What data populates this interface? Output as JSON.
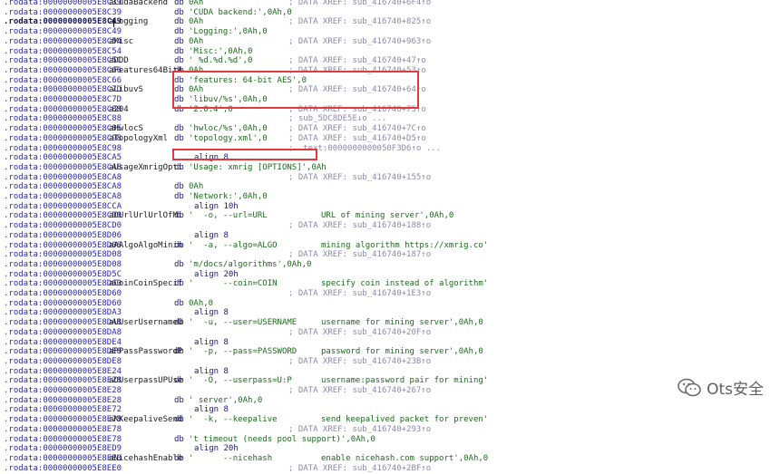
{
  "rows": [
    {
      "addr": ".rodata:00000000005E8C39",
      "label": "aCudaBackend",
      "mn": "db",
      "op": "0Ah",
      "cm": "; DATA XREF: sub_416740+6F4↑o"
    },
    {
      "addr": ".rodata:00000000005E8C39",
      "label": "",
      "mn": "db",
      "op": "'CUDA backend:',0Ah,0",
      "cm": ""
    },
    {
      "addr": ".rodata:00000000005E8C49",
      "label": "aLogging",
      "mn": "db",
      "op": "0Ah",
      "cm": "; DATA XREF: sub_416740+825↑o",
      "hl": true
    },
    {
      "addr": ".rodata:00000000005E8C49",
      "label": "",
      "mn": "db",
      "op": "'Logging:',0Ah,0",
      "cm": ""
    },
    {
      "addr": ".rodata:00000000005E8C54",
      "label": "aMisc",
      "mn": "db",
      "op": "0Ah",
      "cm": "; DATA XREF: sub_416740+963↑o"
    },
    {
      "addr": ".rodata:00000000005E8C54",
      "label": "",
      "mn": "db",
      "op": "'Misc:',0Ah,0",
      "cm": ""
    },
    {
      "addr": ".rodata:00000000005E8C5C",
      "label": "aDDD",
      "mn": "db",
      "op": "' %d.%d.%d',0",
      "cm": "; DATA XREF: sub_416740+47↑o"
    },
    {
      "addr": ".rodata:00000000005E8C66",
      "label": "aFeatures64BitA",
      "mn": "db",
      "op": "0Ah",
      "cm": "; DATA XREF: sub_416740+53↑o"
    },
    {
      "addr": ".rodata:00000000005E8C66",
      "label": "",
      "mn": "db",
      "op": "'features: 64-bit AES',0",
      "cm": ""
    },
    {
      "addr": ".rodata:00000000005E8C7D",
      "label": "aLibuvS",
      "mn": "db",
      "op": "0Ah",
      "cm": "; DATA XREF: sub_416740+64↑o"
    },
    {
      "addr": ".rodata:00000000005E8C7D",
      "label": "",
      "mn": "db",
      "op": "'libuv/%s',0Ah,0",
      "cm": ""
    },
    {
      "addr": ".rodata:00000000005E8C88",
      "label": "a204",
      "mn": "db",
      "op": "'2.0.4',0",
      "cm": "; DATA XREF: sub_416740+75↑o"
    },
    {
      "addr": ".rodata:00000000005E8C88",
      "label": "",
      "mn": "",
      "op": "",
      "cm": "; sub_5DC8DE5E↓o ..."
    },
    {
      "addr": ".rodata:00000000005E8C8E",
      "label": "aHwlocS",
      "mn": "db",
      "op": "'hwloc/%s',0Ah,0",
      "cm": "; DATA XREF: sub_416740+7C↑o"
    },
    {
      "addr": ".rodata:00000000005E8C98",
      "label": "aTopologyXml",
      "mn": "db",
      "op": "'topology.xml',0",
      "cm": "; DATA XREF: sub_416740+D5↑o"
    },
    {
      "addr": ".rodata:00000000005E8C98",
      "label": "",
      "mn": "",
      "op": "",
      "cm": "; .text:0000000000050F3D6↑o ..."
    },
    {
      "addr": ".rodata:00000000005E8CA5",
      "label": "",
      "mn": "align 8",
      "op": "",
      "cm": ""
    },
    {
      "addr": ".rodata:00000000005E8CA8",
      "label": "aUsageXmrigOpti",
      "mn": "db",
      "op": "'Usage: xmrig [OPTIONS]',0Ah",
      "cm": ""
    },
    {
      "addr": ".rodata:00000000005E8CA8",
      "label": "",
      "mn": "",
      "op": "",
      "cm": "; DATA XREF: sub_416740+155↑o"
    },
    {
      "addr": ".rodata:00000000005E8CA8",
      "label": "",
      "mn": "db",
      "op": "0Ah",
      "cm": ""
    },
    {
      "addr": ".rodata:00000000005E8CA8",
      "label": "",
      "mn": "db",
      "op": "'Network:',0Ah,0",
      "cm": ""
    },
    {
      "addr": ".rodata:00000000005E8CCA",
      "label": "",
      "mn": "align 10h",
      "op": "",
      "cm": ""
    },
    {
      "addr": ".rodata:00000000005E8CD0",
      "label": "aOUrlUrlUrlOfMi",
      "mn": "db",
      "op": "'  -o, --url=URL",
      "ex": "URL of mining server',0Ah,0",
      "cm": ""
    },
    {
      "addr": ".rodata:00000000005E8CD0",
      "label": "",
      "mn": "",
      "op": "",
      "cm": "; DATA XREF: sub_416740+188↑o"
    },
    {
      "addr": ".rodata:00000000005E8D06",
      "label": "",
      "mn": "align 8",
      "op": "",
      "cm": ""
    },
    {
      "addr": ".rodata:00000000005E8D08",
      "label": "aAAlgoAlgoMinin",
      "mn": "db",
      "op": "'  -a, --algo=ALGO",
      "ex": "mining algorithm https://xmrig.co'",
      "cm": ""
    },
    {
      "addr": ".rodata:00000000005E8D08",
      "label": "",
      "mn": "",
      "op": "",
      "cm": "; DATA XREF: sub_416740+187↑o"
    },
    {
      "addr": ".rodata:00000000005E8D08",
      "label": "",
      "mn": "db",
      "op": "'m/docs/algorithms',0Ah,0",
      "cm": ""
    },
    {
      "addr": ".rodata:00000000005E8D5C",
      "label": "",
      "mn": "align 20h",
      "op": "",
      "cm": ""
    },
    {
      "addr": ".rodata:00000000005E8D60",
      "label": "aCoinCoinSpecif",
      "mn": "db",
      "op": "'      --coin=COIN",
      "ex": "specify coin instead of algorithm'",
      "cm": ""
    },
    {
      "addr": ".rodata:00000000005E8D60",
      "label": "",
      "mn": "",
      "op": "",
      "cm": "; DATA XREF: sub_416740+1E3↑o"
    },
    {
      "addr": ".rodata:00000000005E8D60",
      "label": "",
      "mn": "db",
      "op": "0Ah,0",
      "cm": ""
    },
    {
      "addr": ".rodata:00000000005E8DA3",
      "label": "",
      "mn": "align 8",
      "op": "",
      "cm": ""
    },
    {
      "addr": ".rodata:00000000005E8DA8",
      "label": "aUUserUsernameU",
      "mn": "db",
      "op": "'  -u, --user=USERNAME",
      "ex": "username for mining server',0Ah,0",
      "cm": ""
    },
    {
      "addr": ".rodata:00000000005E8DA8",
      "label": "",
      "mn": "",
      "op": "",
      "cm": "; DATA XREF: sub_416740+20F↑o"
    },
    {
      "addr": ".rodata:00000000005E8DE4",
      "label": "",
      "mn": "align 8",
      "op": "",
      "cm": ""
    },
    {
      "addr": ".rodata:00000000005E8DE8",
      "label": "aPPassPasswordP",
      "mn": "db",
      "op": "'  -p, --pass=PASSWORD",
      "ex": "password for mining server',0Ah,0",
      "cm": ""
    },
    {
      "addr": ".rodata:00000000005E8DE8",
      "label": "",
      "mn": "",
      "op": "",
      "cm": "; DATA XREF: sub_416740+23B↑o"
    },
    {
      "addr": ".rodata:00000000005E8E24",
      "label": "",
      "mn": "align 8",
      "op": "",
      "cm": ""
    },
    {
      "addr": ".rodata:00000000005E8E28",
      "label": "aOUserpassUPUse",
      "mn": "db",
      "op": "'  -O, --userpass=U:P",
      "ex": "username:password pair for mining'",
      "cm": ""
    },
    {
      "addr": ".rodata:00000000005E8E28",
      "label": "",
      "mn": "",
      "op": "",
      "cm": "; DATA XREF: sub_416740+267↑o"
    },
    {
      "addr": ".rodata:00000000005E8E28",
      "label": "",
      "mn": "db",
      "op": "' server',0Ah,0",
      "cm": ""
    },
    {
      "addr": ".rodata:00000000005E8E72",
      "label": "",
      "mn": "align 8",
      "op": "",
      "cm": ""
    },
    {
      "addr": ".rodata:00000000005E8E78",
      "label": "aKKeepaliveSend",
      "mn": "db",
      "op": "'  -k, --keepalive",
      "ex": "send keepalived packet for preven'",
      "cm": ""
    },
    {
      "addr": ".rodata:00000000005E8E78",
      "label": "",
      "mn": "",
      "op": "",
      "cm": "; DATA XREF: sub_416740+293↑o"
    },
    {
      "addr": ".rodata:00000000005E8E78",
      "label": "",
      "mn": "db",
      "op": "'t timeout (needs pool support)',0Ah,0",
      "cm": ""
    },
    {
      "addr": ".rodata:00000000005E8ED9",
      "label": "",
      "mn": "align 20h",
      "op": "",
      "cm": ""
    },
    {
      "addr": ".rodata:00000000005E8EE0",
      "label": "aNicehashEnable",
      "mn": "db",
      "op": "'      --nicehash",
      "ex": "enable nicehash.com support',0Ah,0",
      "cm": ""
    },
    {
      "addr": ".rodata:00000000005E8EE0",
      "label": "",
      "mn": "",
      "op": "",
      "cm": "; DATA XREF: sub_416740+2BF↑o"
    }
  ],
  "watermark": {
    "text": "Ots安全",
    "icon": "wechat-icon"
  },
  "colors": {
    "highlight_box": "#e23a3a"
  }
}
